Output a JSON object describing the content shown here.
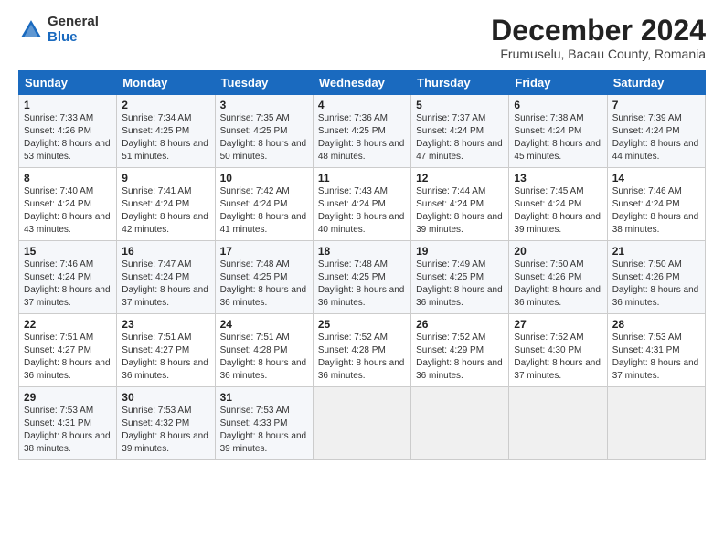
{
  "logo": {
    "general": "General",
    "blue": "Blue"
  },
  "title": "December 2024",
  "location": "Frumuselu, Bacau County, Romania",
  "headers": [
    "Sunday",
    "Monday",
    "Tuesday",
    "Wednesday",
    "Thursday",
    "Friday",
    "Saturday"
  ],
  "weeks": [
    [
      {
        "day": "1",
        "sunrise": "7:33 AM",
        "sunset": "4:26 PM",
        "daylight": "8 hours and 53 minutes."
      },
      {
        "day": "2",
        "sunrise": "7:34 AM",
        "sunset": "4:25 PM",
        "daylight": "8 hours and 51 minutes."
      },
      {
        "day": "3",
        "sunrise": "7:35 AM",
        "sunset": "4:25 PM",
        "daylight": "8 hours and 50 minutes."
      },
      {
        "day": "4",
        "sunrise": "7:36 AM",
        "sunset": "4:25 PM",
        "daylight": "8 hours and 48 minutes."
      },
      {
        "day": "5",
        "sunrise": "7:37 AM",
        "sunset": "4:24 PM",
        "daylight": "8 hours and 47 minutes."
      },
      {
        "day": "6",
        "sunrise": "7:38 AM",
        "sunset": "4:24 PM",
        "daylight": "8 hours and 45 minutes."
      },
      {
        "day": "7",
        "sunrise": "7:39 AM",
        "sunset": "4:24 PM",
        "daylight": "8 hours and 44 minutes."
      }
    ],
    [
      {
        "day": "8",
        "sunrise": "7:40 AM",
        "sunset": "4:24 PM",
        "daylight": "8 hours and 43 minutes."
      },
      {
        "day": "9",
        "sunrise": "7:41 AM",
        "sunset": "4:24 PM",
        "daylight": "8 hours and 42 minutes."
      },
      {
        "day": "10",
        "sunrise": "7:42 AM",
        "sunset": "4:24 PM",
        "daylight": "8 hours and 41 minutes."
      },
      {
        "day": "11",
        "sunrise": "7:43 AM",
        "sunset": "4:24 PM",
        "daylight": "8 hours and 40 minutes."
      },
      {
        "day": "12",
        "sunrise": "7:44 AM",
        "sunset": "4:24 PM",
        "daylight": "8 hours and 39 minutes."
      },
      {
        "day": "13",
        "sunrise": "7:45 AM",
        "sunset": "4:24 PM",
        "daylight": "8 hours and 39 minutes."
      },
      {
        "day": "14",
        "sunrise": "7:46 AM",
        "sunset": "4:24 PM",
        "daylight": "8 hours and 38 minutes."
      }
    ],
    [
      {
        "day": "15",
        "sunrise": "7:46 AM",
        "sunset": "4:24 PM",
        "daylight": "8 hours and 37 minutes."
      },
      {
        "day": "16",
        "sunrise": "7:47 AM",
        "sunset": "4:24 PM",
        "daylight": "8 hours and 37 minutes."
      },
      {
        "day": "17",
        "sunrise": "7:48 AM",
        "sunset": "4:25 PM",
        "daylight": "8 hours and 36 minutes."
      },
      {
        "day": "18",
        "sunrise": "7:48 AM",
        "sunset": "4:25 PM",
        "daylight": "8 hours and 36 minutes."
      },
      {
        "day": "19",
        "sunrise": "7:49 AM",
        "sunset": "4:25 PM",
        "daylight": "8 hours and 36 minutes."
      },
      {
        "day": "20",
        "sunrise": "7:50 AM",
        "sunset": "4:26 PM",
        "daylight": "8 hours and 36 minutes."
      },
      {
        "day": "21",
        "sunrise": "7:50 AM",
        "sunset": "4:26 PM",
        "daylight": "8 hours and 36 minutes."
      }
    ],
    [
      {
        "day": "22",
        "sunrise": "7:51 AM",
        "sunset": "4:27 PM",
        "daylight": "8 hours and 36 minutes."
      },
      {
        "day": "23",
        "sunrise": "7:51 AM",
        "sunset": "4:27 PM",
        "daylight": "8 hours and 36 minutes."
      },
      {
        "day": "24",
        "sunrise": "7:51 AM",
        "sunset": "4:28 PM",
        "daylight": "8 hours and 36 minutes."
      },
      {
        "day": "25",
        "sunrise": "7:52 AM",
        "sunset": "4:28 PM",
        "daylight": "8 hours and 36 minutes."
      },
      {
        "day": "26",
        "sunrise": "7:52 AM",
        "sunset": "4:29 PM",
        "daylight": "8 hours and 36 minutes."
      },
      {
        "day": "27",
        "sunrise": "7:52 AM",
        "sunset": "4:30 PM",
        "daylight": "8 hours and 37 minutes."
      },
      {
        "day": "28",
        "sunrise": "7:53 AM",
        "sunset": "4:31 PM",
        "daylight": "8 hours and 37 minutes."
      }
    ],
    [
      {
        "day": "29",
        "sunrise": "7:53 AM",
        "sunset": "4:31 PM",
        "daylight": "8 hours and 38 minutes."
      },
      {
        "day": "30",
        "sunrise": "7:53 AM",
        "sunset": "4:32 PM",
        "daylight": "8 hours and 39 minutes."
      },
      {
        "day": "31",
        "sunrise": "7:53 AM",
        "sunset": "4:33 PM",
        "daylight": "8 hours and 39 minutes."
      },
      null,
      null,
      null,
      null
    ]
  ]
}
